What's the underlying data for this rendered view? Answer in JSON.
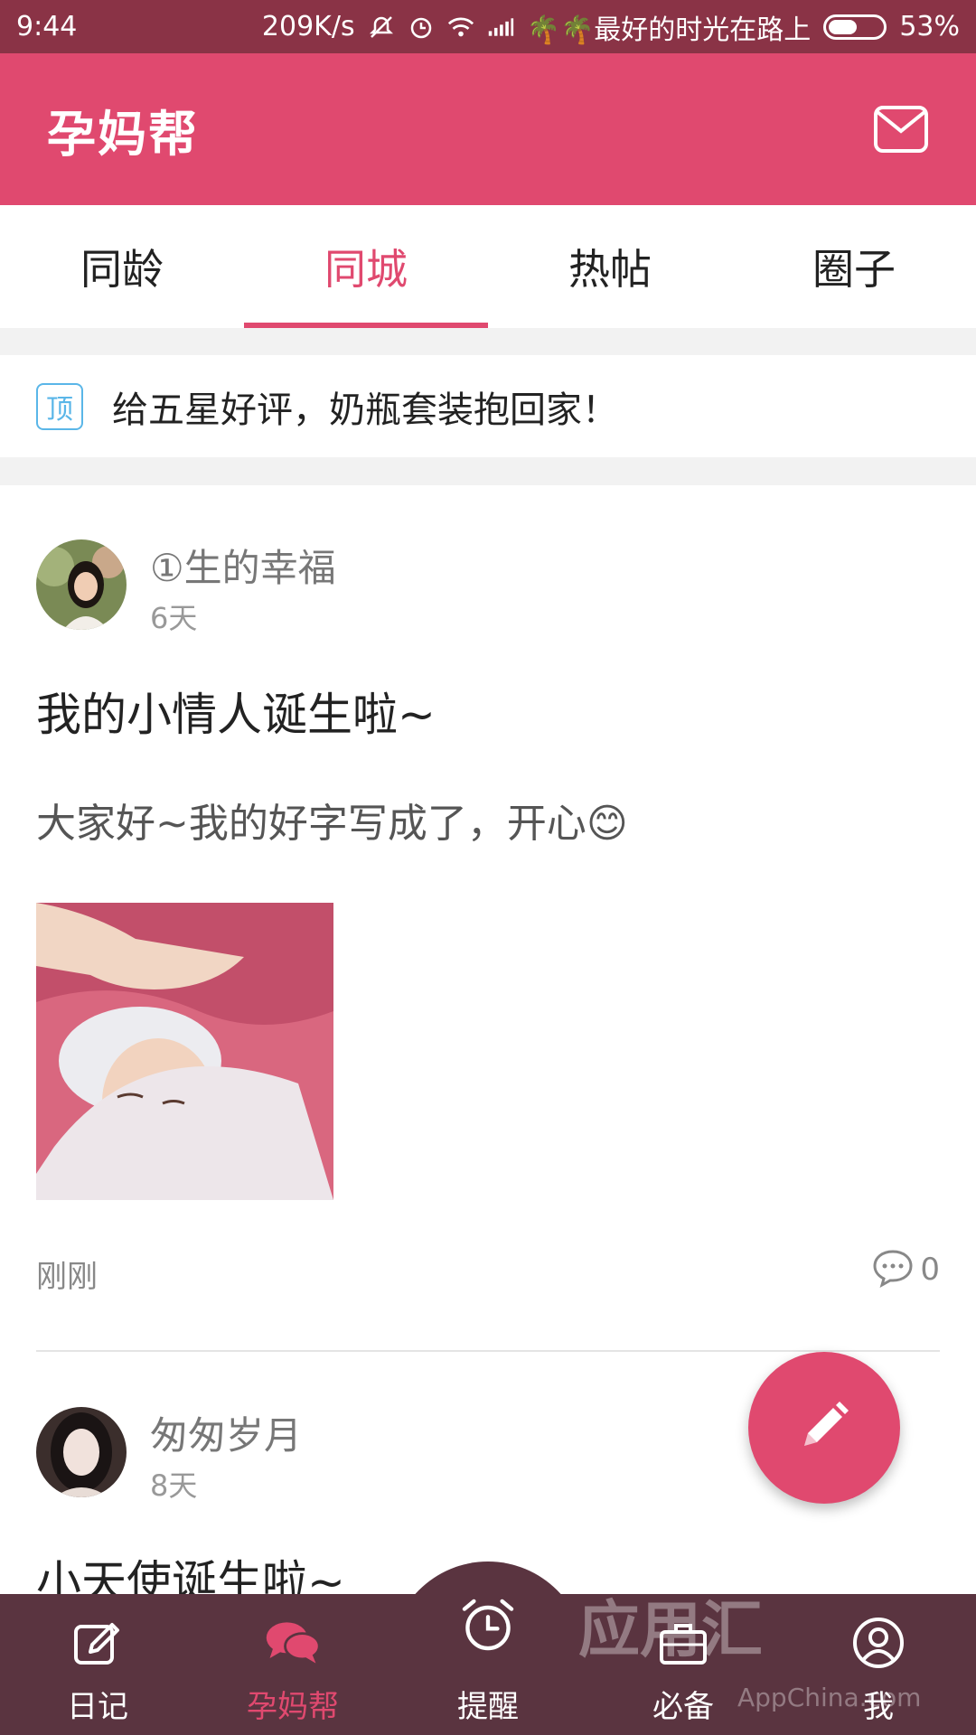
{
  "status_bar": {
    "time": "9:44",
    "speed": "209K/s",
    "carrier": "🌴🌴最好的时光在路上",
    "battery": "53%",
    "battery_level": 0.53
  },
  "app_bar": {
    "title": "孕妈帮"
  },
  "tabs": [
    {
      "label": "同龄"
    },
    {
      "label": "同城"
    },
    {
      "label": "热帖"
    },
    {
      "label": "圈子"
    }
  ],
  "pinned": {
    "badge": "顶",
    "text": "给五星好评，奶瓶套装抱回家！"
  },
  "posts": [
    {
      "author": "①生的幸福",
      "ago": "6天",
      "title": "我的小情人诞生啦~",
      "body": "大家好~我的好字写成了，开心😊",
      "footer_time": "刚刚",
      "comments": "0"
    },
    {
      "author": "匆匆岁月",
      "ago": "8天",
      "title": "小天使诞生啦~"
    }
  ],
  "bottom_nav": [
    {
      "label": "日记",
      "icon": "pencil-icon"
    },
    {
      "label": "孕妈帮",
      "icon": "chat-bubbles-icon"
    },
    {
      "label": "提醒",
      "icon": "alarm-clock-icon"
    },
    {
      "label": "必备",
      "icon": "briefcase-icon"
    },
    {
      "label": "我",
      "icon": "user-icon"
    }
  ],
  "watermark": {
    "main": "应用汇",
    "sub": "AppChina.com"
  },
  "colors": {
    "accent": "#e0496f",
    "status_bar": "#8a3346",
    "bottom_nav": "#5a3440",
    "pin_badge": "#5ab6e8"
  }
}
